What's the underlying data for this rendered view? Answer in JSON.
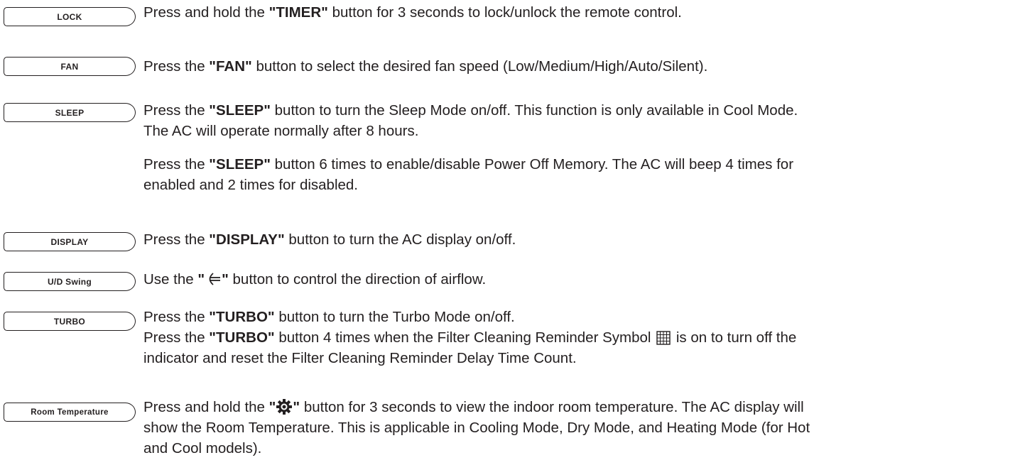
{
  "items": [
    {
      "button": "LOCK",
      "p1_pre": "Press and hold the ",
      "p1_key": "\"TIMER\"",
      "p1_post": " button for 3 seconds to lock/unlock the remote control."
    },
    {
      "button": "FAN",
      "p1_pre": "Press the ",
      "p1_key": "\"FAN\"",
      "p1_post": " button to select the desired fan speed (Low/Medium/High/Auto/Silent)."
    },
    {
      "button": "SLEEP",
      "p1_pre": "Press the ",
      "p1_key": "\"SLEEP\"",
      "p1_post": " button to turn the Sleep Mode on/off. This function is only available in Cool Mode.",
      "p1_line2": "The AC will operate normally after 8 hours.",
      "p2_pre": "Press the ",
      "p2_key": "\"SLEEP\"",
      "p2_post": " button 6 times to enable/disable Power Off Memory. The AC will beep 4 times for",
      "p2_line2": "enabled and 2 times for disabled."
    },
    {
      "button": "DISPLAY",
      "p1_pre": "Press the ",
      "p1_key": "\"DISPLAY\"",
      "p1_post": " button to turn the AC display on/off."
    },
    {
      "button": "U/D Swing",
      "p1_pre": "Use the ",
      "p1_quote_open": "\"",
      "p1_quote_close": "\"",
      "p1_post": " button to control the direction of airflow."
    },
    {
      "button": "TURBO",
      "p1_pre": "Press the ",
      "p1_key": "\"TURBO\"",
      "p1_post": " button to turn the Turbo Mode on/off.",
      "p1b_pre": "Press the ",
      "p1b_key": "\"TURBO\"",
      "p1b_mid": " button 4 times when the Filter Cleaning Reminder Symbol ",
      "p1b_post": " is on to turn off the",
      "p1b_line2": "indicator and reset the Filter Cleaning Reminder Delay Time Count."
    },
    {
      "button": "Room Temperature",
      "p1_pre": "Press and hold the ",
      "p1_quote_open": "\"",
      "p1_quote_close": "\"",
      "p1_post": " button for 3 seconds to view the indoor room temperature. The AC display will",
      "p1_line2": "show the Room Temperature. This is applicable in Cooling Mode, Dry Mode, and Heating Mode (for Hot",
      "p1_line3": "and Cool models)."
    }
  ],
  "icons": {
    "swing": "swing-icon",
    "filter": "filter-grid-icon",
    "temperature": "gear-icon"
  }
}
